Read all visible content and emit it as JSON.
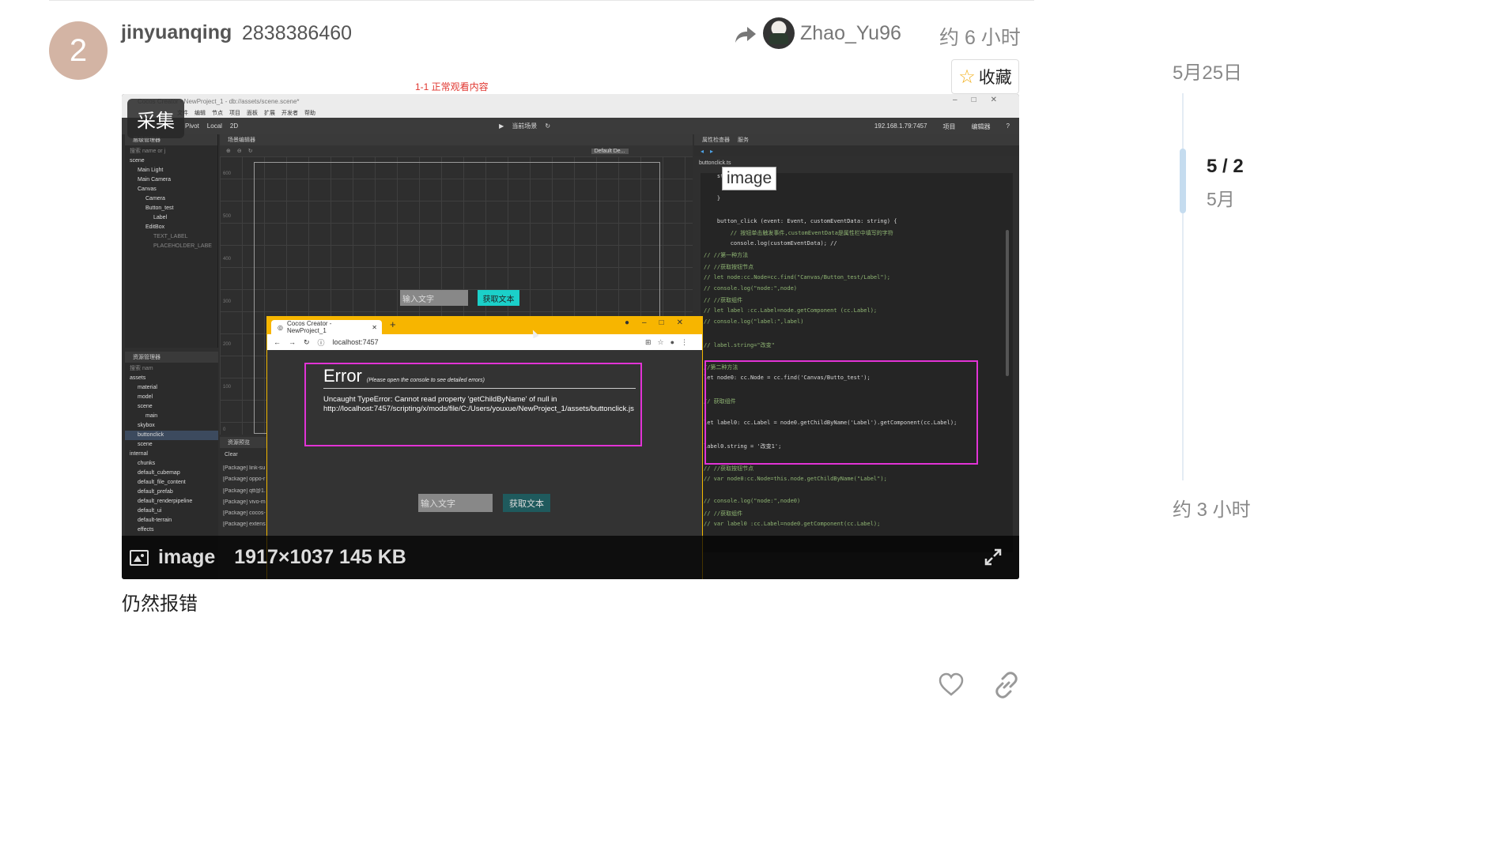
{
  "post": {
    "number": "2",
    "username": "jinyuanqing",
    "user_id": "2838386460",
    "reply_to": "Zhao_Yu96",
    "time": "约 6 小时",
    "collect_label": "收藏",
    "text": "仍然报错"
  },
  "timeline": {
    "top_date": "5月25日",
    "count": "5 / 2",
    "count_date": "5月",
    "bottom_date": "约 3 小时"
  },
  "image": {
    "caption_red": "1-1 正常观看内容",
    "label": "image",
    "meta": "1917×1037 145 KB",
    "caiji": "采集",
    "image_tag": "image",
    "editor": {
      "title": "Cocos Creator - NewProject_1 - db://assets/scene.scene*",
      "menu": [
        "文件",
        "编辑",
        "节点",
        "项目",
        "面板",
        "扩展",
        "开发者",
        "帮助"
      ],
      "tools": [
        "Pivot",
        "Local",
        "2D"
      ],
      "preview_mode": "当前场景",
      "ip": "192.168.1.79:7457",
      "right_tools": [
        "项目",
        "编辑器"
      ],
      "hierarchy_title": "层级管理器",
      "hierarchy_search": "搜索 name or j",
      "hierarchy": [
        {
          "label": "scene",
          "indent": 0
        },
        {
          "label": "Main Light",
          "indent": 1
        },
        {
          "label": "Main Camera",
          "indent": 1
        },
        {
          "label": "Canvas",
          "indent": 1
        },
        {
          "label": "Camera",
          "indent": 2
        },
        {
          "label": "Button_test",
          "indent": 2
        },
        {
          "label": "Label",
          "indent": 3
        },
        {
          "label": "EditBox",
          "indent": 2
        },
        {
          "label": "TEXT_LABEL",
          "indent": 3
        },
        {
          "label": "PLACEHOLDER_LABE",
          "indent": 3
        }
      ],
      "assets_title": "资源管理器",
      "assets_search": "搜索 nam",
      "assets": [
        {
          "label": "assets",
          "indent": 0
        },
        {
          "label": "material",
          "indent": 1
        },
        {
          "label": "model",
          "indent": 1
        },
        {
          "label": "scene",
          "indent": 1
        },
        {
          "label": "main",
          "indent": 2
        },
        {
          "label": "skybox",
          "indent": 1
        },
        {
          "label": "buttonclick",
          "indent": 1
        },
        {
          "label": "scene",
          "indent": 1
        },
        {
          "label": "internal",
          "indent": 0
        },
        {
          "label": "chunks",
          "indent": 1
        },
        {
          "label": "default_cubemap",
          "indent": 1
        },
        {
          "label": "default_file_content",
          "indent": 1
        },
        {
          "label": "default_prefab",
          "indent": 1
        },
        {
          "label": "default_renderpipeline",
          "indent": 1
        },
        {
          "label": "default_ui",
          "indent": 1
        },
        {
          "label": "default-terrain",
          "indent": 1
        },
        {
          "label": "effects",
          "indent": 1
        }
      ],
      "scene_title": "场景编辑器",
      "scene_dropdown": "Default De...",
      "scene_input": "输入文字",
      "scene_button": "获取文本",
      "rulers": [
        "600",
        "500",
        "400",
        "300",
        "200",
        "100",
        "0"
      ],
      "console_title": "资源预览",
      "console_clear": "Clear",
      "console_lines": [
        "[Package] link-su",
        "[Package] oppo-r",
        "[Package] qtt@1.",
        "[Package] vivo-m",
        "[Package] cocos-",
        "[Package] extens"
      ],
      "inspector_tabs": [
        "属性检查器",
        "服务"
      ],
      "code_file": "buttonclick.ts",
      "code_lines": [
        {
          "t": "    st",
          "c": "hl"
        },
        {
          "t": "        // [3]",
          "c": "cm"
        },
        {
          "t": "    }",
          "c": "hl"
        },
        {
          "t": "",
          "c": "hl"
        },
        {
          "t": "    button_click (event: Event, customEventData: string) {",
          "c": "hl"
        },
        {
          "t": "        // 按钮单击触发事件,customEventData是属性栏中填写的字符",
          "c": "cm"
        },
        {
          "t": "        console.log(customEventData); //",
          "c": "hl"
        },
        {
          "t": "// //第一种方法",
          "c": "cm"
        },
        {
          "t": "// //获取按钮节点",
          "c": "cm"
        },
        {
          "t": "// let node:cc.Node=cc.find(\"Canvas/Button_test/Label\");",
          "c": "cm"
        },
        {
          "t": "// console.log(\"node:\",node)",
          "c": "cm"
        },
        {
          "t": "// //获取组件",
          "c": "cm"
        },
        {
          "t": "// let label :cc.Label=node.getComponent (cc.Label);",
          "c": "cm"
        },
        {
          "t": "// console.log(\"label:\",label)",
          "c": "cm"
        },
        {
          "t": "",
          "c": "hl"
        },
        {
          "t": "// label.string=\"改变\"",
          "c": "cm"
        },
        {
          "t": "",
          "c": "hl"
        },
        {
          "t": "//第二种方法",
          "c": "cm"
        },
        {
          "t": "let node0: cc.Node = cc.find('Canvas/Butto_test');",
          "c": "hl"
        },
        {
          "t": "",
          "c": "hl"
        },
        {
          "t": "// 获取组件",
          "c": "cm"
        },
        {
          "t": "",
          "c": "hl"
        },
        {
          "t": "let label0: cc.Label = node0.getChildByName('Label').getComponent(cc.Label);",
          "c": "hl"
        },
        {
          "t": "",
          "c": "hl"
        },
        {
          "t": "label0.string = '改变1';",
          "c": "hl"
        },
        {
          "t": "",
          "c": "hl"
        },
        {
          "t": "// //获取按钮节点",
          "c": "cm"
        },
        {
          "t": "// var node0:cc.Node=this.node.getChildByName(\"Label\");",
          "c": "cm"
        },
        {
          "t": "",
          "c": "hl"
        },
        {
          "t": "// console.log(\"node:\",node0)",
          "c": "cm"
        },
        {
          "t": "// //获取组件",
          "c": "cm"
        },
        {
          "t": "// var label0 :cc.Label=node0.getComponent(cc.Label);",
          "c": "cm"
        }
      ]
    },
    "browser": {
      "tab_title": "Cocos Creator - NewProject_1",
      "url": "localhost:7457",
      "error_title": "Error",
      "error_subtitle": "(Please open the console to see detailed errors)",
      "error_message": "Uncaught TypeError: Cannot read property 'getChildByName' of null in http://localhost:7457/scripting/x/mods/file/C:/Users/youxue/NewProject_1/assets/buttonclick.js",
      "input_placeholder": "输入文字",
      "button_label": "获取文本"
    }
  },
  "colors": {
    "avatar": "#d3b4a4",
    "star": "#f2b01e",
    "highlight_box": "#e233d6",
    "browser_accent": "#f7b500",
    "scene_button": "#1bd0c9"
  }
}
